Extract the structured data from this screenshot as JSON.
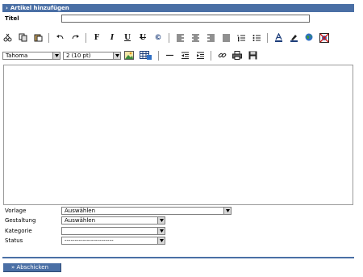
{
  "header": {
    "title": "Artikel hinzufügen"
  },
  "form": {
    "title_label": "Titel",
    "title_value": ""
  },
  "toolbar": {
    "font_select": "Tahoma",
    "size_select": "2 (10 pt)",
    "buttons_row1": [
      "cut-icon",
      "copy-icon",
      "paste-icon",
      "undo-icon",
      "redo-icon",
      "bold-icon",
      "italic-icon",
      "underline-icon",
      "strikethrough-icon",
      "copyright-icon",
      "align-left-icon",
      "align-center-icon",
      "align-right-icon",
      "justify-icon",
      "ordered-list-icon",
      "unordered-list-icon",
      "text-color-icon",
      "highlight-icon",
      "globe-icon",
      "remove-format-icon"
    ],
    "buttons_row2": [
      "image-icon",
      "table-icon",
      "horizontal-rule-icon",
      "outdent-icon",
      "indent-icon",
      "link-icon",
      "print-icon",
      "save-icon"
    ],
    "glyphs": {
      "bold": "F",
      "italic": "I",
      "underline": "U",
      "strike": "U",
      "copyright": "©"
    }
  },
  "fields": {
    "vorlage": {
      "label": "Vorlage",
      "value": "Auswählen"
    },
    "gestaltung": {
      "label": "Gestaltung",
      "value": "Auswählen"
    },
    "kategorie": {
      "label": "Kategorie",
      "value": ""
    },
    "status": {
      "label": "Status",
      "value": "------------------------"
    }
  },
  "submit": {
    "label": "» Abschicken"
  },
  "colors": {
    "accent": "#4a6fa5"
  }
}
